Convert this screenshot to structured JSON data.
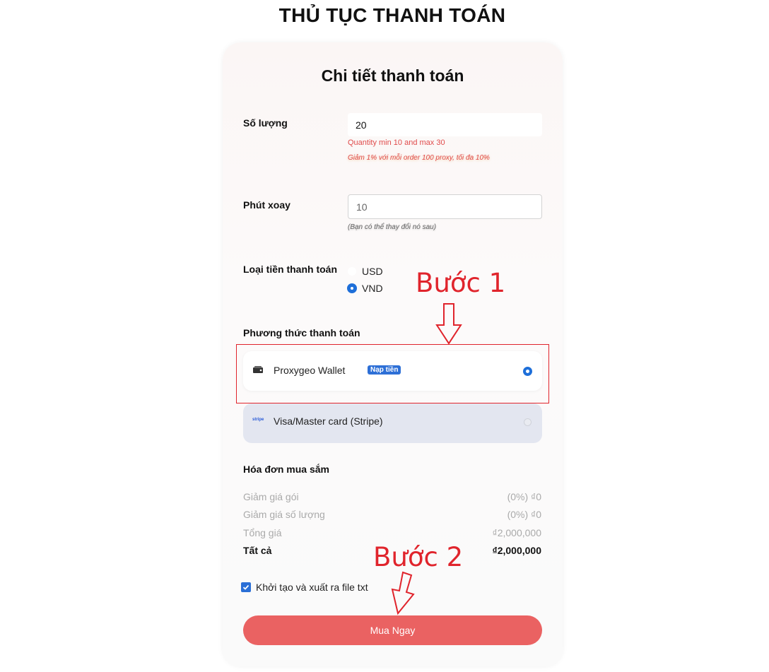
{
  "page": {
    "title": "THỦ TỤC THANH TOÁN"
  },
  "card": {
    "title": "Chi tiết thanh toán"
  },
  "quantity": {
    "label": "Số lượng",
    "value": "20",
    "hint": "Quantity min 10 and max 30",
    "discount_hint": "Giảm 1% với mỗi order 100 proxy, tối đa 10%"
  },
  "rotate": {
    "label": "Phút xoay",
    "value": "10",
    "hint": "(Bạn có thể thay đổi nó sau)"
  },
  "currency": {
    "label": "Loại tiền thanh toán",
    "options": [
      {
        "label": "USD",
        "selected": false
      },
      {
        "label": "VND",
        "selected": true
      }
    ]
  },
  "payment": {
    "label": "Phương thức thanh toán",
    "options": [
      {
        "name": "Proxygeo Wallet",
        "badge": "Nạp tiền",
        "icon": "wallet-icon",
        "icon_text": "",
        "selected": true
      },
      {
        "name": "Visa/Master card (Stripe)",
        "badge": "",
        "icon": "stripe-icon",
        "icon_text": "stripe",
        "selected": false
      }
    ]
  },
  "invoice": {
    "title": "Hóa đơn mua sắm",
    "rows": [
      {
        "label": "Giảm giá gói",
        "value": "(0%) ₫0"
      },
      {
        "label": "Giảm giá số lượng",
        "value": "(0%) ₫0"
      },
      {
        "label": "Tổng giá",
        "value": "₫2,000,000"
      },
      {
        "label": "Tất cả",
        "value": "₫2,000,000"
      }
    ]
  },
  "export": {
    "label": "Khởi tạo và xuất ra file txt",
    "checked": true
  },
  "buy_button": {
    "label": "Mua Ngay"
  },
  "annotations": {
    "step1": "Bước 1",
    "step2": "Bước 2",
    "color": "#e0242c"
  },
  "colors": {
    "accent": "#1e6fd9",
    "buy": "#ea6262",
    "error": "#e04b4b"
  }
}
